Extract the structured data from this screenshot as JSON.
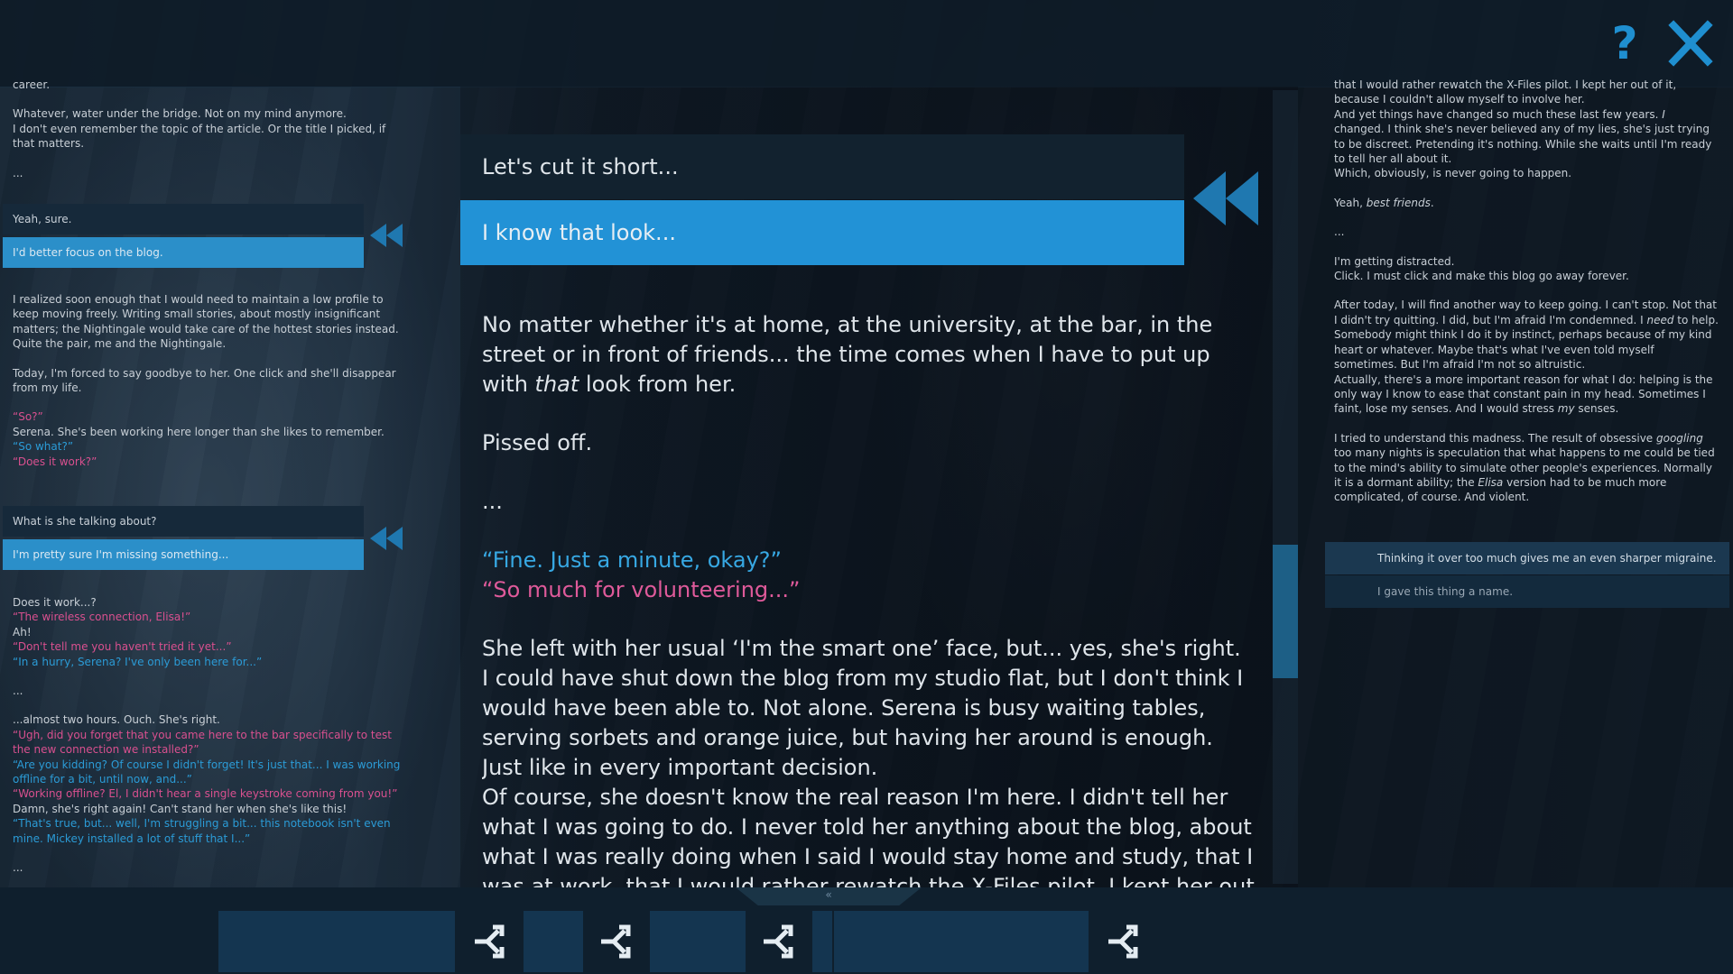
{
  "top_bar": {
    "help_icon": "?"
  },
  "left_log": {
    "block1": [
      "career.",
      "",
      "Whatever, water under the bridge. Not on my mind anymore.",
      "I don't even remember the topic of the article. Or the title I picked, if that matters.",
      "",
      "..."
    ],
    "choices1": {
      "dark": "Yeah, sure.",
      "light": "I'd better focus on the blog."
    },
    "block2": [
      {
        "t": "I realized soon enough that I would need to maintain a low profile to keep moving freely. Writing small stories, about mostly insignificant matters; the Nightingale would take care of the hottest stories instead.",
        "c": ""
      },
      {
        "t": "Quite the pair, me and the Nightingale.",
        "c": ""
      },
      {
        "t": "",
        "c": ""
      },
      {
        "t": "Today, I'm forced to say goodbye to her. One click and she'll disappear from my life.",
        "c": ""
      },
      {
        "t": "",
        "c": ""
      },
      {
        "t": "“So?”",
        "c": "pink"
      },
      {
        "t": "Serena. She's been working here longer than she likes to remember.",
        "c": ""
      },
      {
        "t": "“So what?”",
        "c": "blue"
      },
      {
        "t": "“Does it work?”",
        "c": "pink"
      }
    ],
    "choices2": {
      "dark": "What is she talking about?",
      "light": "I'm pretty sure I'm missing something..."
    },
    "block3": [
      {
        "t": "Does it work...?",
        "c": ""
      },
      {
        "t": "“The wireless connection, Elisa!”",
        "c": "pink"
      },
      {
        "t": "Ah!",
        "c": ""
      },
      {
        "t": "“Don't tell me you haven't tried it yet...”",
        "c": "pink"
      },
      {
        "t": "“In a hurry, Serena? I've only been here for...”",
        "c": "blue"
      },
      {
        "t": "",
        "c": ""
      },
      {
        "t": "...",
        "c": ""
      },
      {
        "t": "",
        "c": ""
      },
      {
        "t": "...almost two hours. Ouch. She's right.",
        "c": ""
      },
      {
        "t": "“Ugh, did you forget that you came here to the bar specifically to test the new connection we installed?”",
        "c": "pink"
      },
      {
        "t": "“Are you kidding? Of course I didn't forget! It's just that... I was working offline for a bit, until now, and...”",
        "c": "blue"
      },
      {
        "t": "“Working offline? El, I didn't hear a single keystroke coming from you!”",
        "c": "pink"
      },
      {
        "t": "Damn, she's right again! Can't stand her when she's like this!",
        "c": ""
      },
      {
        "t": "“That's true, but... well, I'm struggling a bit... this notebook isn't even mine. Mickey installed a lot of stuff that I...”",
        "c": "blue"
      },
      {
        "t": "",
        "c": ""
      },
      {
        "t": "...",
        "c": ""
      }
    ]
  },
  "center": {
    "choice_dark": "Let's cut it short...",
    "choice_light": "I know that look...",
    "p1_before": "No matter whether it's at home, at the university, at the bar, in the street or in front of friends... the time comes when I have to put up with ",
    "p1_em": "that",
    "p1_after": " look from her.",
    "p2": "Pissed off.",
    "p3": "...",
    "q1": "“Fine. Just a minute, okay?”",
    "q2": "“So much for volunteering...”",
    "p4": "She left with her usual ‘I'm the smart one’ face, but... yes, she's right.",
    "p5": "I could have shut down the blog from my studio flat, but I don't think I would have been able to. Not alone. Serena is busy waiting tables, serving sorbets and orange juice, but having her around is enough. Just like in every important decision.",
    "p6": "Of course, she doesn't know the real reason I'm here. I didn't tell her what I was going to do. I never told her anything about the blog, about what I was really doing when I said I would stay home and study, that I was at work, that I would rather rewatch the X-Files pilot. I kept her out of it, because I couldn't allow myself to involve her."
  },
  "right_log": {
    "lines": [
      {
        "parts": [
          {
            "t": "that I would rather rewatch the X-Files pilot. I kept her out of it, because I couldn't allow myself to involve her."
          }
        ]
      },
      {
        "parts": [
          {
            "t": "And yet things have changed so much these last few years. "
          },
          {
            "t": "I",
            "i": true
          },
          {
            "t": " changed. I think she's never believed any of my lies, she's just trying to be discreet. Pretending it's nothing. While she waits until I'm ready to tell her all about it."
          }
        ]
      },
      {
        "parts": [
          {
            "t": "Which, obviously, is never going to happen."
          }
        ]
      },
      {
        "gap": true
      },
      {
        "parts": [
          {
            "t": "Yeah, "
          },
          {
            "t": "best friends",
            "i": true
          },
          {
            "t": "."
          }
        ]
      },
      {
        "gap": true
      },
      {
        "parts": [
          {
            "t": "..."
          }
        ]
      },
      {
        "gap": true
      },
      {
        "parts": [
          {
            "t": "I'm getting distracted."
          }
        ]
      },
      {
        "parts": [
          {
            "t": "Click. I must click and make this blog go away forever."
          }
        ]
      },
      {
        "gap": true
      },
      {
        "parts": [
          {
            "t": "After today, I will find another way to keep going. I can't stop. Not that I didn't try quitting. I did, but I'm afraid I'm condemned. I "
          },
          {
            "t": "need",
            "i": true
          },
          {
            "t": " to help. Somebody might think I do it by instinct, perhaps because of my kind heart or whatever. Maybe that's what I've even told myself sometimes. But I'm afraid I'm not so altruistic."
          }
        ]
      },
      {
        "parts": [
          {
            "t": "Actually, there's a more important reason for what I do: helping is the only way I know to ease that constant pain in my head. Sometimes I faint, lose my senses. And I would stress "
          },
          {
            "t": "my",
            "i": true
          },
          {
            "t": " senses."
          }
        ]
      },
      {
        "gap": true
      },
      {
        "parts": [
          {
            "t": "I tried to understand this madness. The result of obsessive "
          },
          {
            "t": "googling",
            "i": true
          },
          {
            "t": " too many nights is speculation that what happens to me could be tied to the mind's ability to simulate other people's experiences. Normally it is a dormant ability; the "
          },
          {
            "t": "Elisa",
            "i": true
          },
          {
            "t": " version had to be much more complicated, of course. And violent."
          }
        ]
      }
    ],
    "option1": "Thinking it over too much gives me an even sharper migraine.",
    "option2": "I gave this thing a name."
  },
  "bottom": {
    "tab_icon": "«"
  },
  "colors": {
    "accent": "#2292d6",
    "pink": "#df5a9a",
    "blue": "#37a8e3"
  }
}
